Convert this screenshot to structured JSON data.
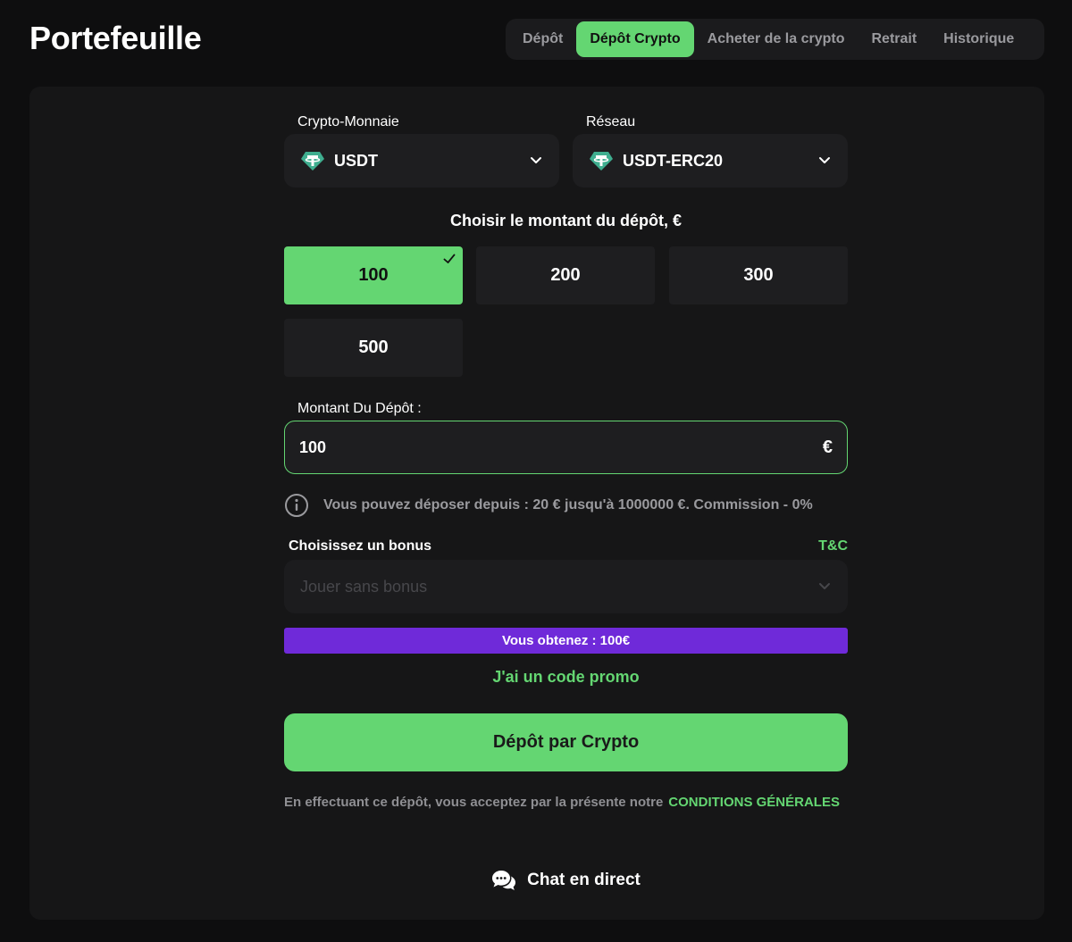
{
  "header": {
    "title": "Portefeuille",
    "tabs": [
      {
        "label": "Dépôt",
        "active": false
      },
      {
        "label": "Dépôt Crypto",
        "active": true
      },
      {
        "label": "Acheter de la crypto",
        "active": false
      },
      {
        "label": "Retrait",
        "active": false
      },
      {
        "label": "Historique",
        "active": false
      }
    ]
  },
  "form": {
    "currency_label": "Crypto-Monnaie",
    "currency_value": "USDT",
    "network_label": "Réseau",
    "network_value": "USDT-ERC20",
    "coin_icon": "tether-icon",
    "amount_heading": "Choisir le montant du dépôt, €",
    "preset_amounts": [
      {
        "value": "100",
        "selected": true
      },
      {
        "value": "200",
        "selected": false
      },
      {
        "value": "300",
        "selected": false
      },
      {
        "value": "500",
        "selected": false
      }
    ],
    "amount_label": "Montant Du Dépôt :",
    "amount_value": "100",
    "amount_currency": "€",
    "info_text": "Vous pouvez déposer depuis : 20 € jusqu'à 1000000 €. Commission - 0%",
    "bonus_label": "Choisissez un bonus",
    "tc_link": "T&C",
    "bonus_placeholder": "Jouer sans bonus",
    "result_text": "Vous obtenez : 100€",
    "promo_link": "J'ai un code promo",
    "submit_label": "Dépôt par Crypto",
    "terms_text": "En effectuant ce dépôt, vous acceptez par la présente notre",
    "terms_link": "CONDITIONS GÉNÉRALES",
    "chat_label": "Chat en direct"
  },
  "colors": {
    "accent": "#64d672",
    "bonus_bar": "#6f2ad9",
    "background": "#0e0e0f",
    "card": "#161617"
  }
}
